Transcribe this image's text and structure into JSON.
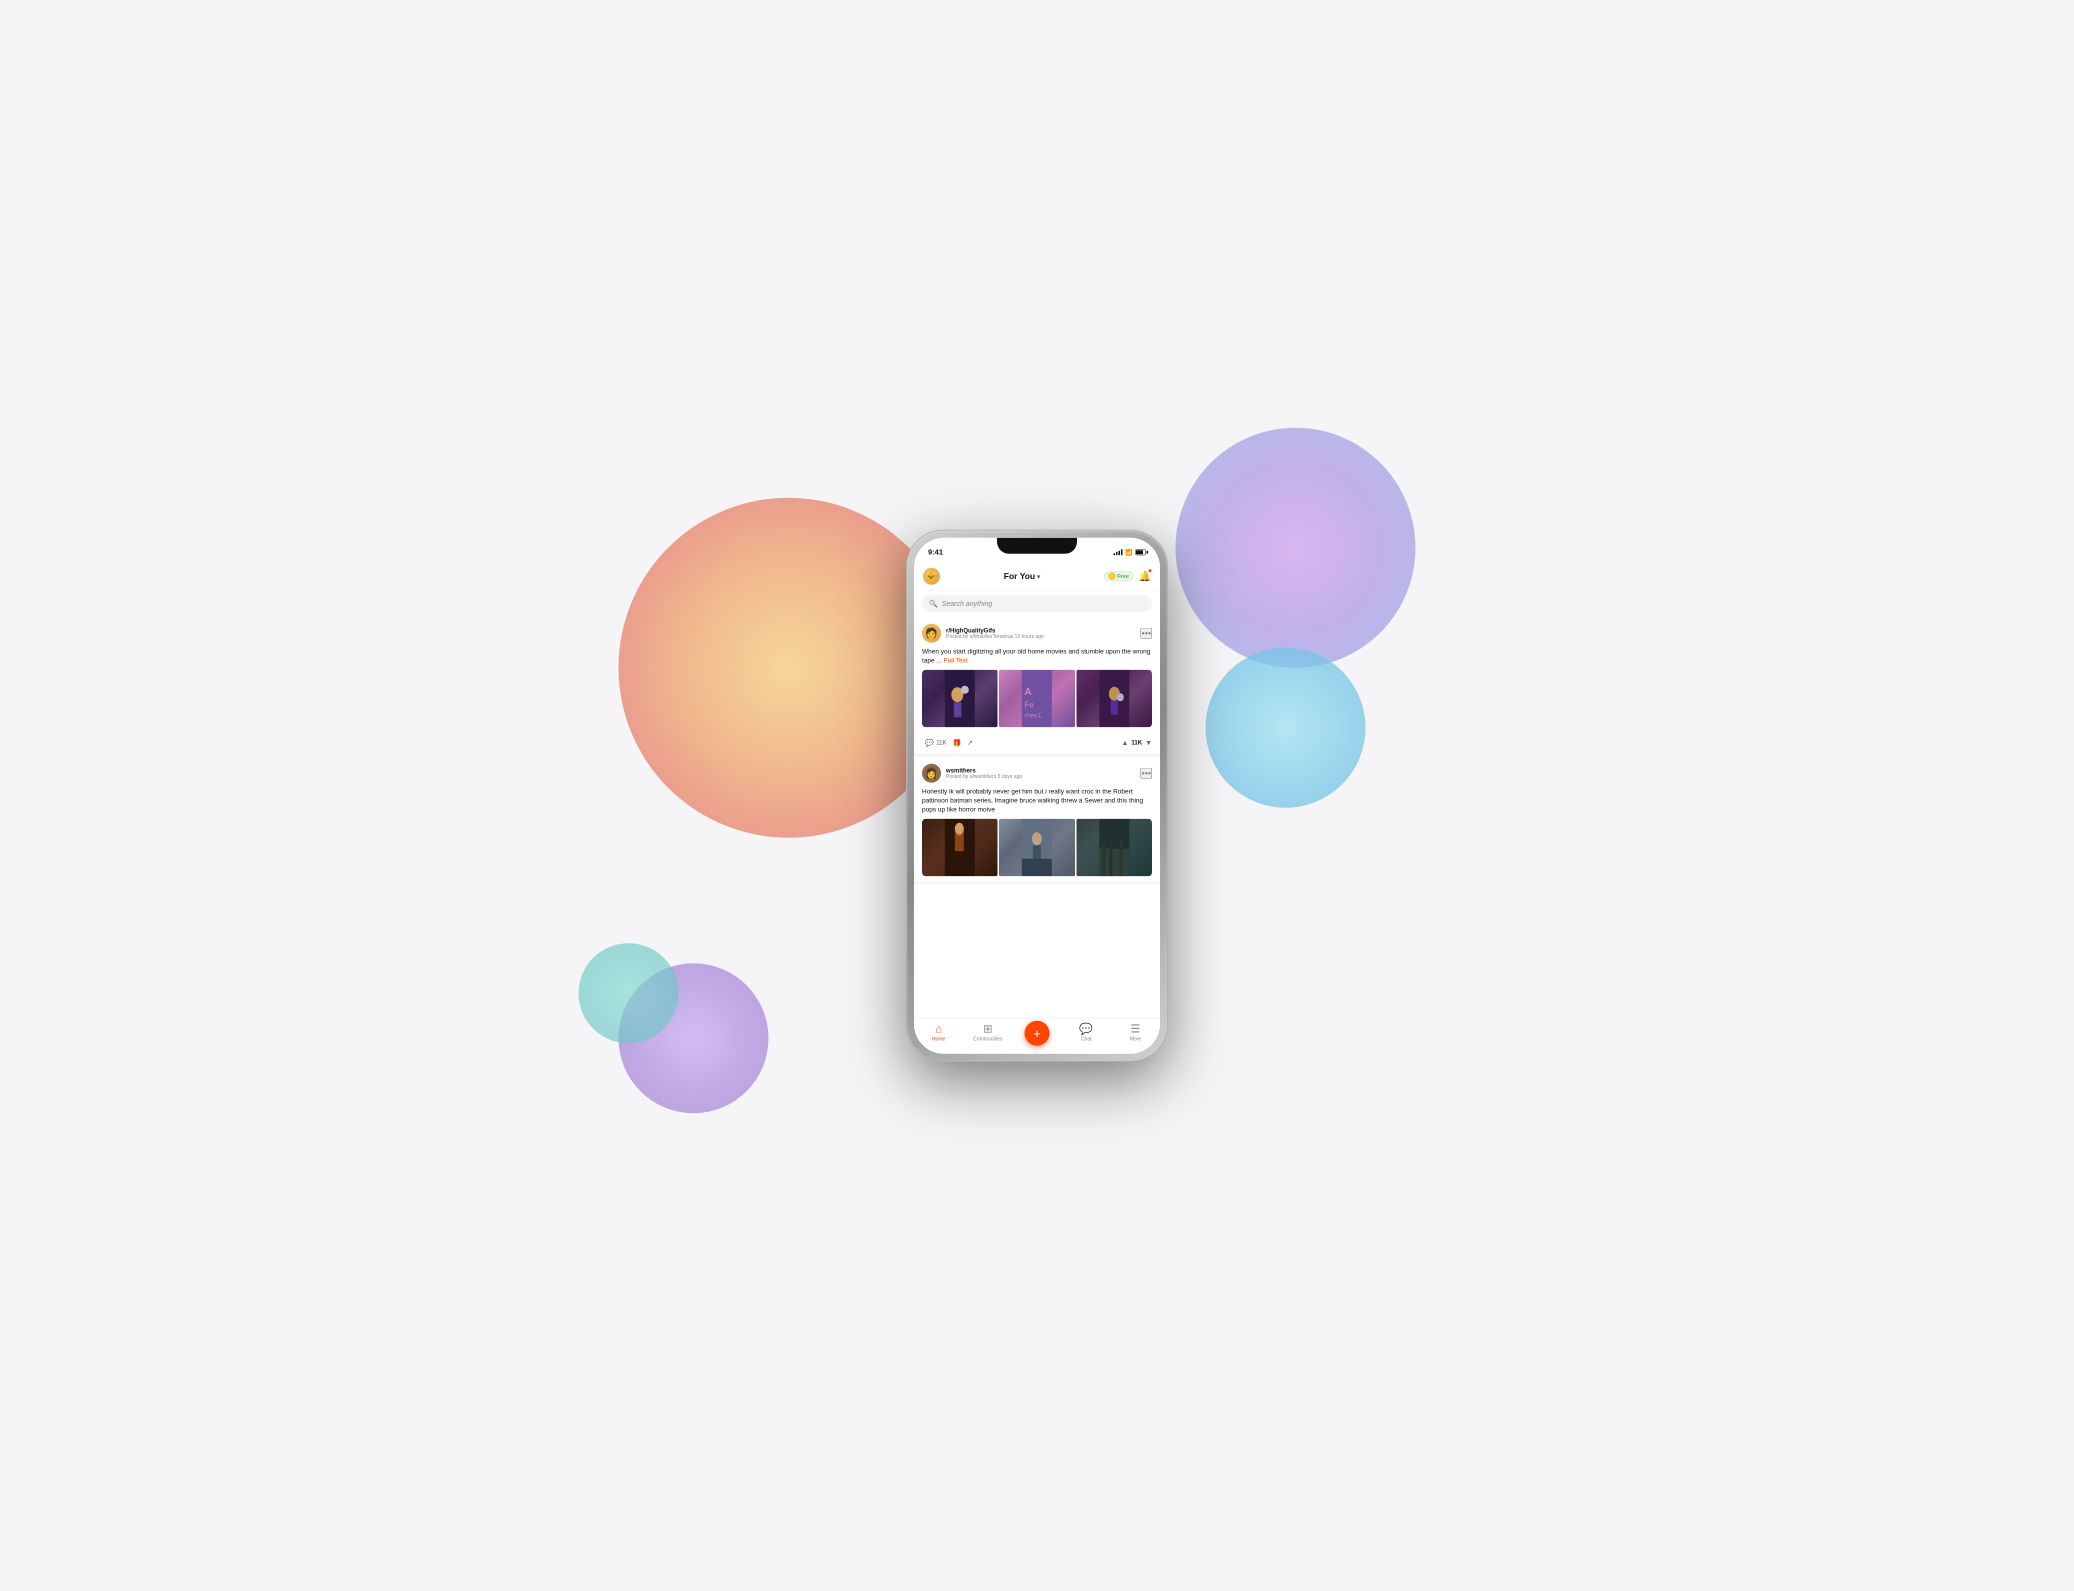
{
  "background": {
    "color": "#f5f5f7"
  },
  "phone": {
    "status_bar": {
      "time": "9:41",
      "signal_label": "signal",
      "wifi_label": "wifi",
      "battery_label": "battery"
    },
    "header": {
      "avatar_emoji": "🐱",
      "title": "For You",
      "dropdown_char": "▾",
      "free_badge": "Free",
      "notification_label": "notifications"
    },
    "search": {
      "placeholder": "Search anything",
      "icon_label": "search"
    },
    "posts": [
      {
        "id": "post1",
        "subreddit": "r/HighQualityGifs",
        "byline": "Posted by u/MulciberTenebras  13 hours ago",
        "text": "When you start digitizing all your old home movies and stumble upon the wrong tape ...",
        "full_text_link": "Full Text",
        "comments": "11K",
        "upvotes": "11K",
        "images": [
          {
            "style": "cartoon-dark",
            "label": "gif-frame-1"
          },
          {
            "style": "cartoon-pink",
            "label": "gif-frame-2"
          },
          {
            "style": "cartoon-dark2",
            "label": "gif-frame-3"
          }
        ]
      },
      {
        "id": "post2",
        "subreddit": "wsmithers",
        "byline": "Posted by u/wsmithers  5 days ago",
        "text": "Honestly ik will probably never get him but i really want croc in the Robert pattinson batman series, Imagine bruce walking threw a Sewer and this thing pops up like horror moive",
        "full_text_link": null,
        "images": [
          {
            "style": "movie-dark",
            "label": "movie-frame-1"
          },
          {
            "style": "movie-gray",
            "label": "movie-frame-2"
          },
          {
            "style": "movie-forest",
            "label": "movie-frame-3"
          }
        ]
      }
    ],
    "bottom_nav": {
      "items": [
        {
          "label": "Home",
          "icon": "home",
          "active": true
        },
        {
          "label": "Communities",
          "icon": "grid",
          "active": false
        },
        {
          "label": "",
          "icon": "fab",
          "active": false
        },
        {
          "label": "Chat",
          "icon": "chat",
          "active": false
        },
        {
          "label": "More",
          "icon": "more",
          "active": false
        }
      ],
      "fab_label": "+"
    }
  }
}
